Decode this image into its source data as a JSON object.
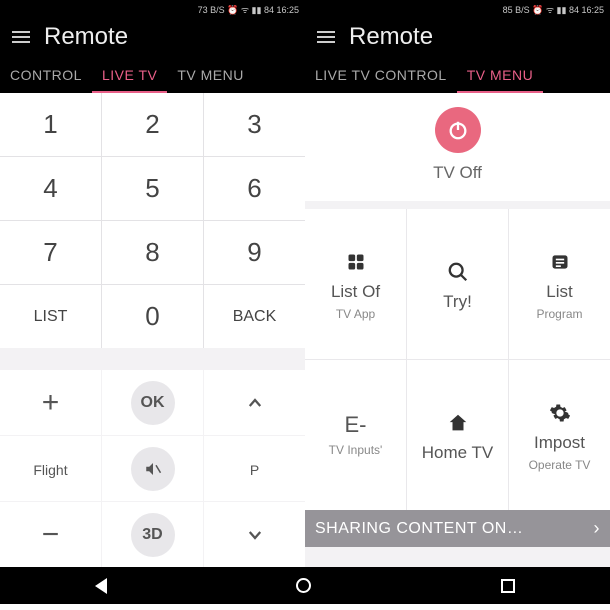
{
  "left": {
    "status": "73 B/S ⏰ ᯤ ▮▮ 84 16:25",
    "app_title": "Remote",
    "tabs": {
      "control": "CONTROL",
      "live": "LIVE TV",
      "menu": "TV MENU"
    },
    "keys": {
      "k1": "1",
      "k2": "2",
      "k3": "3",
      "k4": "4",
      "k5": "5",
      "k6": "6",
      "k7": "7",
      "k8": "8",
      "k9": "9",
      "list": "LIST",
      "k0": "0",
      "back": "BACK"
    },
    "controls": {
      "plus": "+",
      "ok": "OK",
      "minus": "−",
      "flight": "Flight",
      "threed": "3D",
      "p": "P"
    }
  },
  "right": {
    "status": "85 B/S ⏰ ᯤ ▮▮ 84 16:25",
    "app_title": "Remote",
    "tabs": {
      "livecontrol": "LIVE TV CONTROL",
      "menu": "TV MENU"
    },
    "power_label": "TV Off",
    "tiles": {
      "a": {
        "t1": "List Of",
        "t2": "TV App"
      },
      "b": {
        "t1": "Try!"
      },
      "c": {
        "t1": "List",
        "t2": "Program"
      },
      "d": {
        "t1": "E-",
        "t2": "TV  Inputs'"
      },
      "e": {
        "t1": "Home TV"
      },
      "f": {
        "t1": "Impost",
        "t2": "Operate TV"
      }
    },
    "banner": "SHARING CONTENT ON…"
  }
}
